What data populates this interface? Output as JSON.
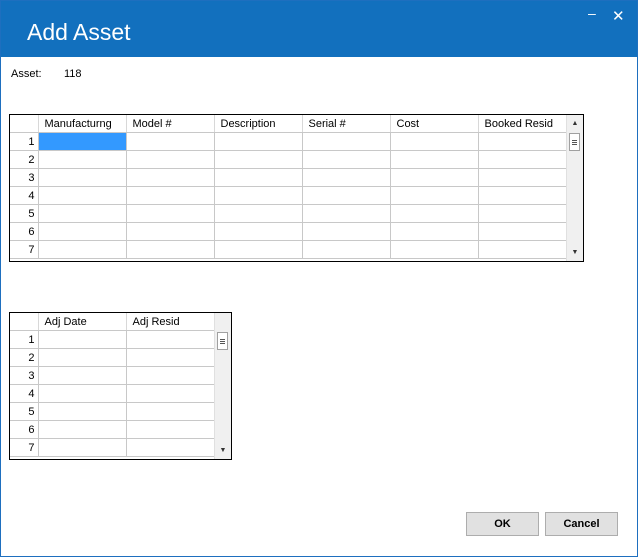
{
  "window": {
    "title": "Add Asset",
    "minimize_glyph": "–",
    "close_glyph": "✕"
  },
  "asset": {
    "label": "Asset:",
    "value": "118"
  },
  "asset_grid": {
    "columns": [
      "Manufacturng",
      "Model #",
      "Description",
      "Serial #",
      "Cost",
      "Booked Resid"
    ],
    "rows": [
      "1",
      "2",
      "3",
      "4",
      "5",
      "6",
      "7"
    ]
  },
  "resid_grid": {
    "columns": [
      "Adj Date",
      "Adj Resid"
    ],
    "rows": [
      "1",
      "2",
      "3",
      "4",
      "5",
      "6",
      "7"
    ]
  },
  "buttons": {
    "ok": "OK",
    "cancel": "Cancel"
  },
  "colors": {
    "titlebar": "#1270be",
    "selected_cell": "#3399ff"
  }
}
